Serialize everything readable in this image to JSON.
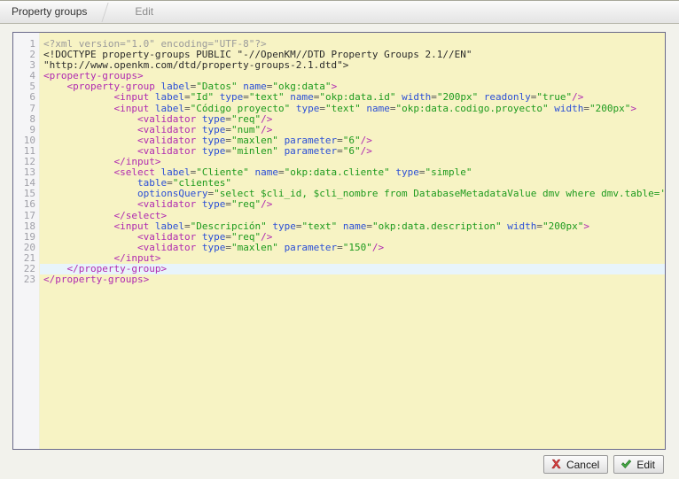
{
  "breadcrumb": {
    "items": [
      {
        "label": "Property groups",
        "active": true
      },
      {
        "label": "Edit",
        "active": false
      }
    ]
  },
  "editor": {
    "language": "xml",
    "active_line": 22,
    "total_lines": 23,
    "line_numbers": [
      "1",
      "2",
      "3",
      "4",
      "5",
      "6",
      "7",
      "8",
      "9",
      "10",
      "11",
      "12",
      "13",
      "14",
      "15",
      "16",
      "17",
      "18",
      "19",
      "20",
      "21",
      "22",
      "23"
    ],
    "lines": [
      "<?xml version=\"1.0\" encoding=\"UTF-8\"?>",
      "<!DOCTYPE property-groups PUBLIC \"-//OpenKM//DTD Property Groups 2.1//EN\"",
      "\"http://www.openkm.com/dtd/property-groups-2.1.dtd\">",
      "<property-groups>",
      "    <property-group label=\"Datos\" name=\"okg:data\">",
      "            <input label=\"Id\" type=\"text\" name=\"okp:data.id\" width=\"200px\" readonly=\"true\"/>",
      "            <input label=\"Código proyecto\" type=\"text\" name=\"okp:data.codigo.proyecto\" width=\"200px\">",
      "                <validator type=\"req\"/>",
      "                <validator type=\"num\"/>",
      "                <validator type=\"maxlen\" parameter=\"6\"/>",
      "                <validator type=\"minlen\" parameter=\"6\"/>",
      "            </input>",
      "            <select label=\"Cliente\" name=\"okp:data.cliente\" type=\"simple\"",
      "                table=\"clientes\"",
      "                optionsQuery=\"select $cli_id, $cli_nombre from DatabaseMetadataValue dmv where dmv.table='clientes'\">",
      "                <validator type=\"req\"/>",
      "            </select>",
      "            <input label=\"Descripción\" type=\"text\" name=\"okp:data.description\" width=\"200px\">",
      "                <validator type=\"req\"/>",
      "                <validator type=\"maxlen\" parameter=\"150\"/>",
      "            </input>",
      "    </property-group>",
      "</property-groups>"
    ]
  },
  "buttons": {
    "cancel_label": "Cancel",
    "edit_label": "Edit",
    "cancel_icon": "red-x-icon",
    "edit_icon": "green-check-icon"
  },
  "colors": {
    "editor_background": "#f7f3c4",
    "gutter_background": "#f5f5f7",
    "active_line": "#e8f4fb",
    "editor_border": "#6a6a8a",
    "page_background": "#f2f2ec",
    "tag": "#b02ab0",
    "attribute": "#2b4fd6",
    "value": "#1d9a1d",
    "processing_instruction": "#9a9a9a",
    "doctype": "#2b2b2b",
    "cancel_icon_color": "#cc3333",
    "edit_icon_color": "#3a9e3a"
  }
}
